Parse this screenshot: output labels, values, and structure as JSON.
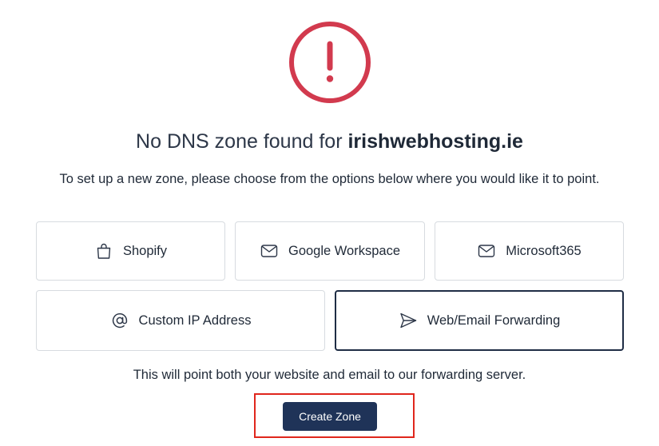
{
  "colors": {
    "alert_red": "#d23a4e",
    "button_bg": "#1f3358",
    "highlight_red": "#e0261c",
    "selected_border": "#1f2d45"
  },
  "header": {
    "title_prefix": "No DNS zone found for ",
    "domain": "irishwebhosting.ie",
    "subtitle": "To set up a new zone, please choose from the options below where you would like it to point."
  },
  "options": [
    {
      "label": "Shopify",
      "icon": "shopping-bag-icon",
      "selected": false
    },
    {
      "label": "Google Workspace",
      "icon": "mail-icon",
      "selected": false
    },
    {
      "label": "Microsoft365",
      "icon": "mail-icon",
      "selected": false
    },
    {
      "label": "Custom IP Address",
      "icon": "at-sign-icon",
      "selected": false
    },
    {
      "label": "Web/Email Forwarding",
      "icon": "send-icon",
      "selected": true
    }
  ],
  "note": "This will point both your website and email to our forwarding server.",
  "actions": {
    "create_label": "Create Zone"
  }
}
